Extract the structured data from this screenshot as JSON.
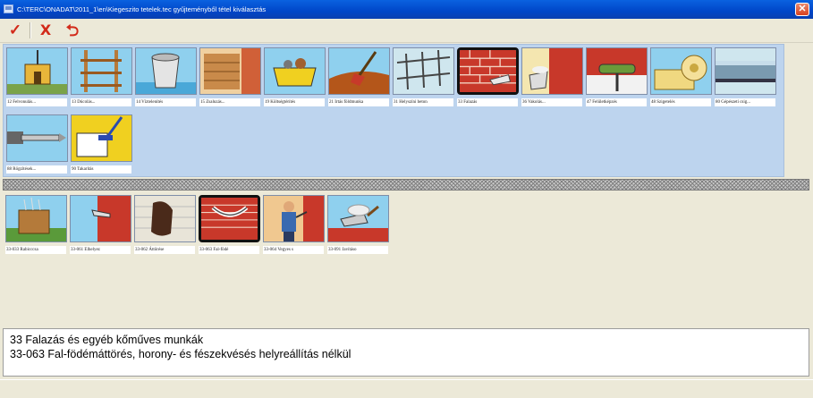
{
  "window": {
    "title": "C:\\TERC\\ONADAT\\2011_1\\en\\Kiegeszito tetelek.tec gyűjteményből tétel kiválasztás"
  },
  "toolbar": {
    "ok_glyph": "✓",
    "cancel_glyph": "X",
    "back_glyph": "⮌"
  },
  "groups": [
    {
      "label": "12 Felvonulás...",
      "icon": "hut-icon",
      "selected": false
    },
    {
      "label": "13 Dúcolás...",
      "icon": "shoring-icon",
      "selected": false
    },
    {
      "label": "14 Víztelenítés",
      "icon": "bucket-icon",
      "selected": false
    },
    {
      "label": "15 Zsaluzás...",
      "icon": "formwork-icon",
      "selected": false
    },
    {
      "label": "19 Költségtérítés",
      "icon": "skip-container-icon",
      "selected": false
    },
    {
      "label": "21 Irtás földmunka",
      "icon": "shovel-icon",
      "selected": false
    },
    {
      "label": "31 Helyszíni beton",
      "icon": "rebar-icon",
      "selected": false
    },
    {
      "label": "33 Falazás",
      "icon": "brick-wall-icon",
      "selected": true
    },
    {
      "label": "36 Vakolás...",
      "icon": "plastering-icon",
      "selected": false
    },
    {
      "label": "47 Felületképzés",
      "icon": "paint-roller-icon",
      "selected": false
    },
    {
      "label": "48 Szigetelés",
      "icon": "insulation-roll-icon",
      "selected": false
    },
    {
      "label": "80 Gépészeti csig...",
      "icon": "pipe-icon",
      "selected": false
    },
    {
      "label": "88 Rögzítések...",
      "icon": "anchor-bolt-icon",
      "selected": false
    },
    {
      "label": "90 Takarítás",
      "icon": "cleaning-icon",
      "selected": false
    }
  ],
  "items": [
    {
      "label": "33-033 Rabicccsa",
      "icon": "rabitz-icon",
      "selected": false
    },
    {
      "label": "33-061 Elhelyez",
      "icon": "wall-hook-icon",
      "selected": false
    },
    {
      "label": "33-062 Áttörése",
      "icon": "wall-breakthrough-icon",
      "selected": false
    },
    {
      "label": "33-063 Fal-födé",
      "icon": "wall-chase-icon",
      "selected": true
    },
    {
      "label": "33-064 Vegyes s",
      "icon": "worker-icon",
      "selected": false
    },
    {
      "label": "33-091 Javításo",
      "icon": "trowel-icon",
      "selected": false
    }
  ],
  "description": {
    "line1": "33 Falazás és egyéb kőműves munkák",
    "line2": "33-063 Fal-födémáttörés, horony- és fészekvésés helyreállítás nélkül"
  },
  "colors": {
    "titlebar": "#0046c8",
    "group_panel": "#bdd4ee",
    "brick": "#c8382a",
    "sky": "#7fc6e8"
  }
}
